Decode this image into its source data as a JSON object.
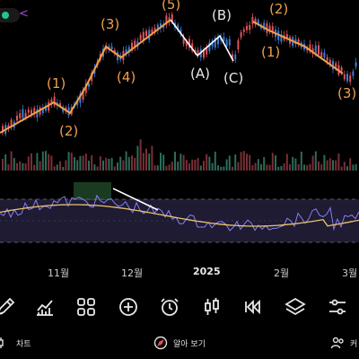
{
  "colors": {
    "up": "#e0535b",
    "down": "#3b7dd8",
    "wave_line": "#f0a04b",
    "correction_line": "#ffffff",
    "rsi_line": "#8a7df0",
    "signal_line": "#e9c46a",
    "rsi_band": "#1e1b33"
  },
  "wave_labels": [
    {
      "id": "w1",
      "text": "(1)",
      "color": "orange"
    },
    {
      "id": "w2",
      "text": "(2)",
      "color": "orange"
    },
    {
      "id": "w3",
      "text": "(3)",
      "color": "orange"
    },
    {
      "id": "w4",
      "text": "(4)",
      "color": "orange"
    },
    {
      "id": "w5",
      "text": "(5)",
      "color": "orange"
    },
    {
      "id": "wa",
      "text": "(A)",
      "color": "white"
    },
    {
      "id": "wb",
      "text": "(B)",
      "color": "white"
    },
    {
      "id": "wc",
      "text": "(C)",
      "color": "white"
    },
    {
      "id": "w1b",
      "text": "(1)",
      "color": "orange"
    },
    {
      "id": "w2b",
      "text": "(2)",
      "color": "orange"
    },
    {
      "id": "w3b",
      "text": "(3)",
      "color": "orange"
    }
  ],
  "x_axis": {
    "m11": "11월",
    "m12": "12월",
    "y2025": "2025",
    "m2": "2월",
    "m3": "3월"
  },
  "toolbar_icons": [
    "pencil-icon",
    "line-chart-icon",
    "grid-icon",
    "plus-circle-icon",
    "alarm-icon",
    "candlestick-icon",
    "rewind-icon",
    "layers-icon",
    "sliders-icon"
  ],
  "bottom_nav": {
    "chart": "차트",
    "quick_view": "알아 보기",
    "community": "커"
  }
}
